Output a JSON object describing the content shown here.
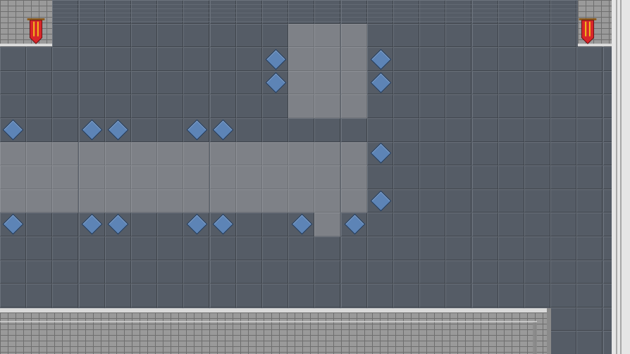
{
  "scene": {
    "type": "dungeon-room",
    "floor_colors": {
      "dark": "#555c66",
      "light": "#7e8187"
    },
    "marker_color": "#5d84b6",
    "banner_colors": {
      "cloth": "#d8262a",
      "trim": "#f2c21b",
      "rod": "#8a5a1a"
    }
  },
  "banners": [
    {
      "name": "left-banner-icon"
    },
    {
      "name": "right-banner-icon"
    }
  ]
}
